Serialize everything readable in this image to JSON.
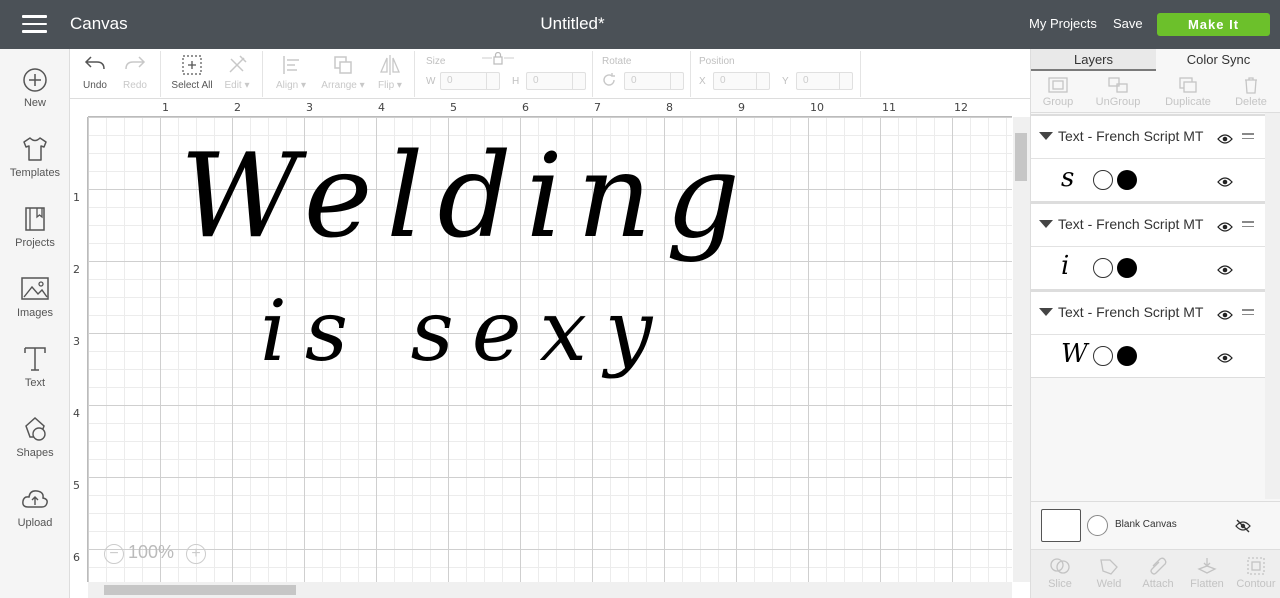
{
  "header": {
    "app_title": "Canvas",
    "doc_title": "Untitled*",
    "my_projects": "My Projects",
    "save": "Save",
    "make_it": "Make It",
    "accent_color": "#6cc02b"
  },
  "leftnav": {
    "items": [
      {
        "label": "New",
        "icon": "plus-circle-icon"
      },
      {
        "label": "Templates",
        "icon": "tshirt-icon"
      },
      {
        "label": "Projects",
        "icon": "bookmark-book-icon"
      },
      {
        "label": "Images",
        "icon": "image-icon"
      },
      {
        "label": "Text",
        "icon": "text-t-icon"
      },
      {
        "label": "Shapes",
        "icon": "shapes-icon"
      },
      {
        "label": "Upload",
        "icon": "cloud-upload-icon"
      }
    ]
  },
  "toolbar": {
    "undo": "Undo",
    "redo": "Redo",
    "select_all": "Select All",
    "edit": "Edit",
    "align": "Align",
    "arrange": "Arrange",
    "flip": "Flip",
    "size_label": "Size",
    "w_label": "W",
    "h_label": "H",
    "w_value": "0",
    "h_value": "0",
    "rotate_label": "Rotate",
    "rotate_value": "0",
    "position_label": "Position",
    "x_label": "X",
    "y_label": "Y",
    "x_value": "0",
    "y_value": "0"
  },
  "canvas": {
    "ruler_h": [
      "1",
      "2",
      "3",
      "4",
      "5",
      "6",
      "7",
      "8",
      "9",
      "10",
      "11",
      "12"
    ],
    "ruler_v": [
      "1",
      "2",
      "3",
      "4",
      "5",
      "6"
    ],
    "line1": "Welding",
    "line2": "is sexy",
    "zoom": "100%",
    "zoom_minus": "−",
    "zoom_plus": "+"
  },
  "panel": {
    "tab_layers": "Layers",
    "tab_color_sync": "Color Sync",
    "tools": [
      "Group",
      "UnGroup",
      "Duplicate",
      "Delete"
    ],
    "layers": [
      {
        "name": "Text - French Script MT",
        "glyph": "s"
      },
      {
        "name": "Text - French Script MT",
        "glyph": "i"
      },
      {
        "name": "Text - French Script MT",
        "glyph": "W"
      }
    ],
    "blank_canvas": "Blank Canvas",
    "bottom_tools": [
      "Slice",
      "Weld",
      "Attach",
      "Flatten",
      "Contour"
    ]
  }
}
